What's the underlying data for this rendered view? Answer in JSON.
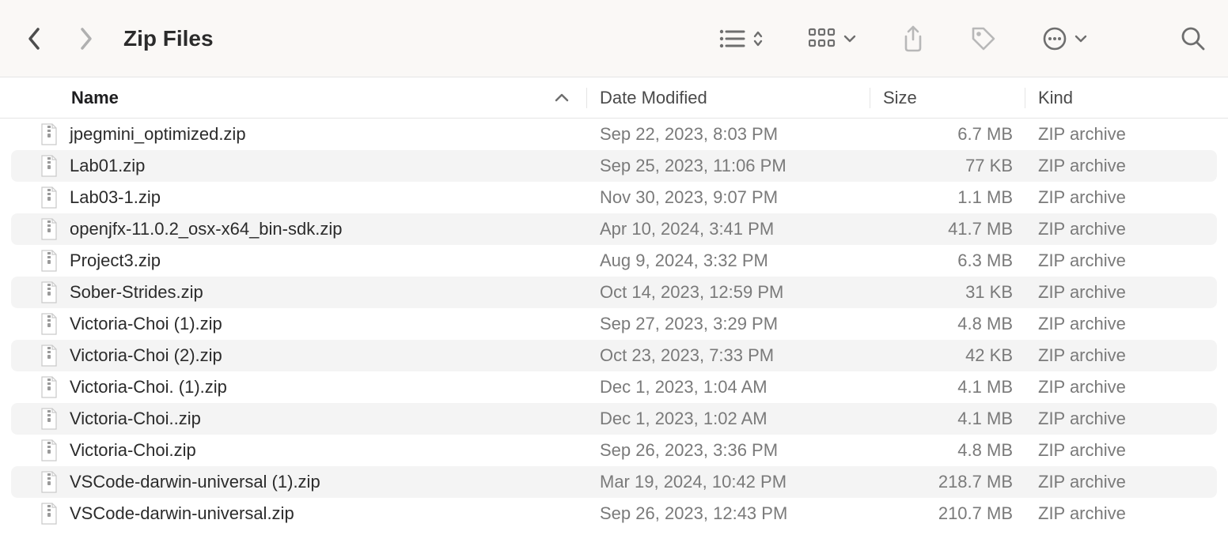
{
  "window": {
    "title": "Zip Files"
  },
  "columns": {
    "name": "Name",
    "date": "Date Modified",
    "size": "Size",
    "kind": "Kind"
  },
  "files": [
    {
      "name": "jpegmini_optimized.zip",
      "date": "Sep 22, 2023, 8:03 PM",
      "size": "6.7 MB",
      "kind": "ZIP archive"
    },
    {
      "name": "Lab01.zip",
      "date": "Sep 25, 2023, 11:06 PM",
      "size": "77 KB",
      "kind": "ZIP archive"
    },
    {
      "name": "Lab03-1.zip",
      "date": "Nov 30, 2023, 9:07 PM",
      "size": "1.1 MB",
      "kind": "ZIP archive"
    },
    {
      "name": "openjfx-11.0.2_osx-x64_bin-sdk.zip",
      "date": "Apr 10, 2024, 3:41 PM",
      "size": "41.7 MB",
      "kind": "ZIP archive"
    },
    {
      "name": "Project3.zip",
      "date": "Aug 9, 2024, 3:32 PM",
      "size": "6.3 MB",
      "kind": "ZIP archive"
    },
    {
      "name": "Sober-Strides.zip",
      "date": "Oct 14, 2023, 12:59 PM",
      "size": "31 KB",
      "kind": "ZIP archive"
    },
    {
      "name": "Victoria-Choi (1).zip",
      "date": "Sep 27, 2023, 3:29 PM",
      "size": "4.8 MB",
      "kind": "ZIP archive"
    },
    {
      "name": "Victoria-Choi (2).zip",
      "date": "Oct 23, 2023, 7:33 PM",
      "size": "42 KB",
      "kind": "ZIP archive"
    },
    {
      "name": "Victoria-Choi. (1).zip",
      "date": "Dec 1, 2023, 1:04 AM",
      "size": "4.1 MB",
      "kind": "ZIP archive"
    },
    {
      "name": "Victoria-Choi..zip",
      "date": "Dec 1, 2023, 1:02 AM",
      "size": "4.1 MB",
      "kind": "ZIP archive"
    },
    {
      "name": "Victoria-Choi.zip",
      "date": "Sep 26, 2023, 3:36 PM",
      "size": "4.8 MB",
      "kind": "ZIP archive"
    },
    {
      "name": "VSCode-darwin-universal (1).zip",
      "date": "Mar 19, 2024, 10:42 PM",
      "size": "218.7 MB",
      "kind": "ZIP archive"
    },
    {
      "name": "VSCode-darwin-universal.zip",
      "date": "Sep 26, 2023, 12:43 PM",
      "size": "210.7 MB",
      "kind": "ZIP archive"
    }
  ]
}
